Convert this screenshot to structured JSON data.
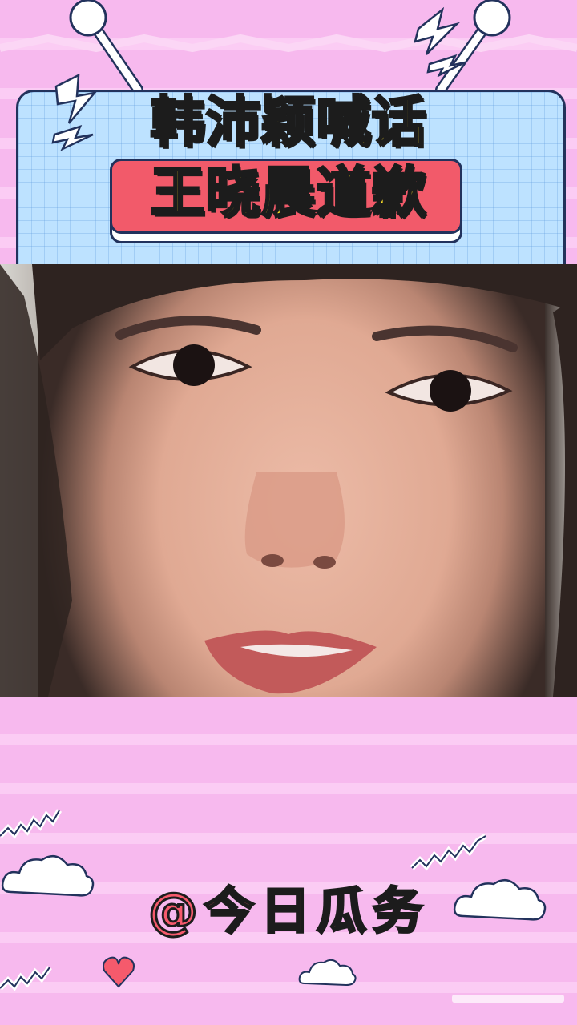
{
  "header": {
    "title_line1": "韩沛颖喊话",
    "title_line2": "王晓晨道歉"
  },
  "video": {
    "description_icon": "video-frame"
  },
  "footer": {
    "handle": "@今日瓜务"
  },
  "colors": {
    "background": "#f7b9ee",
    "header_card": "#bde2ff",
    "title_yellow": "#ffe227",
    "banner_red": "#f25a6a",
    "handle_red": "#f55a6c"
  }
}
